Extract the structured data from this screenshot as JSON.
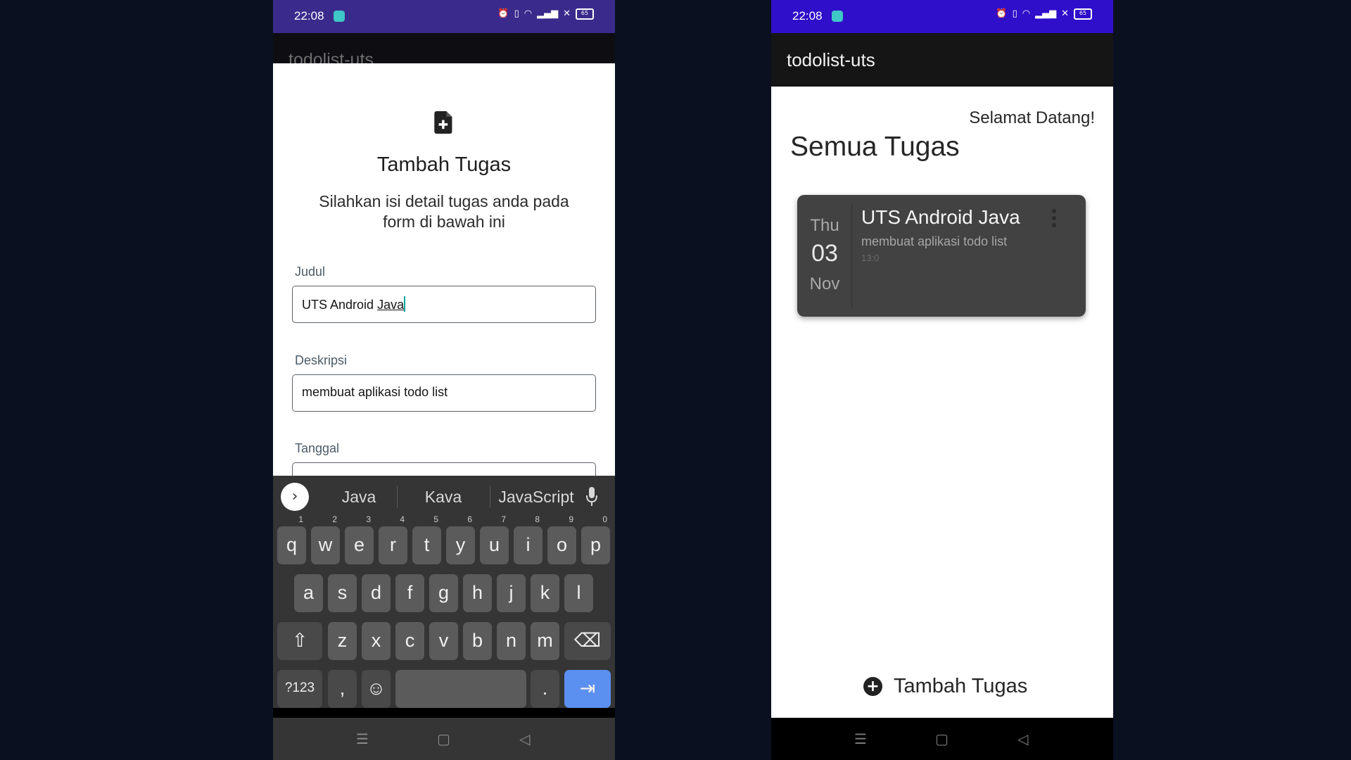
{
  "left": {
    "status": {
      "time": "22:08",
      "battery": "65"
    },
    "appbar_title": "todolist-uts",
    "sheet": {
      "title": "Tambah Tugas",
      "subtitle": "Silahkan isi detail tugas anda pada form di bawah ini",
      "fields": {
        "judul_label": "Judul",
        "judul_prefix": "UTS Android ",
        "judul_word": "Java",
        "deskripsi_label": "Deskripsi",
        "deskripsi_value": "membuat aplikasi todo list",
        "tanggal_label": "Tanggal"
      }
    },
    "keyboard": {
      "suggestions": [
        "Java",
        "Kava",
        "JavaScript"
      ],
      "row1": [
        [
          "q",
          "1"
        ],
        [
          "w",
          "2"
        ],
        [
          "e",
          "3"
        ],
        [
          "r",
          "4"
        ],
        [
          "t",
          "5"
        ],
        [
          "y",
          "6"
        ],
        [
          "u",
          "7"
        ],
        [
          "i",
          "8"
        ],
        [
          "o",
          "9"
        ],
        [
          "p",
          "0"
        ]
      ],
      "row2": [
        "a",
        "s",
        "d",
        "f",
        "g",
        "h",
        "j",
        "k",
        "l"
      ],
      "row3": [
        "z",
        "x",
        "c",
        "v",
        "b",
        "n",
        "m"
      ],
      "symbols_key": "?123",
      "comma_key": ",",
      "period_key": "."
    }
  },
  "right": {
    "status": {
      "time": "22:08",
      "battery": "65"
    },
    "appbar_title": "todolist-uts",
    "welcome": "Selamat Datang!",
    "section_title": "Semua Tugas",
    "task": {
      "dow": "Thu",
      "day": "03",
      "month": "Nov",
      "title": "UTS Android Java",
      "description": "membuat aplikasi todo list",
      "time": "13:0"
    },
    "add_label": "Tambah Tugas"
  },
  "colors": {
    "status_left": "#3a2a8c",
    "status_right": "#2f0fc9",
    "card": "#424242",
    "enter_key": "#5b8ff0",
    "cursor": "#00a79a"
  }
}
